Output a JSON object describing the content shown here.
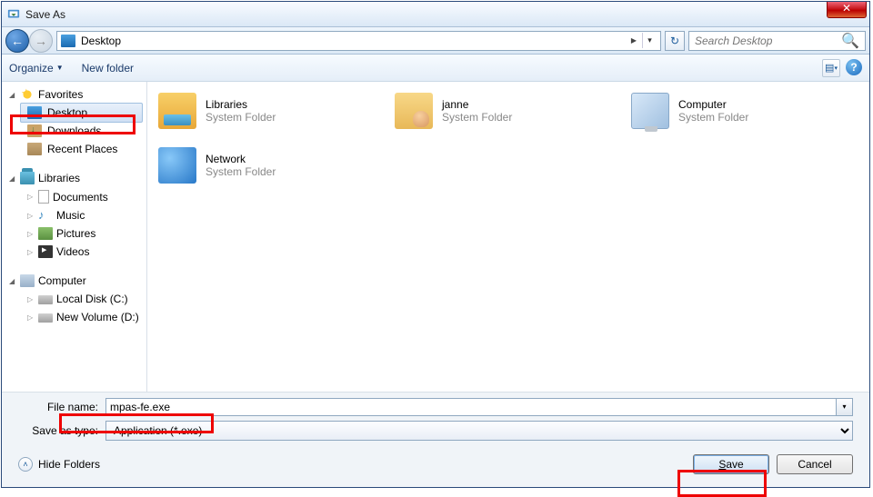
{
  "title": "Save As",
  "addressbar": {
    "location": "Desktop"
  },
  "search": {
    "placeholder": "Search Desktop"
  },
  "toolbar": {
    "organize": "Organize",
    "newfolder": "New folder"
  },
  "nav": {
    "favorites": {
      "label": "Favorites",
      "items": [
        {
          "label": "Desktop"
        },
        {
          "label": "Downloads"
        },
        {
          "label": "Recent Places"
        }
      ]
    },
    "libraries": {
      "label": "Libraries",
      "items": [
        {
          "label": "Documents"
        },
        {
          "label": "Music"
        },
        {
          "label": "Pictures"
        },
        {
          "label": "Videos"
        }
      ]
    },
    "computer": {
      "label": "Computer",
      "items": [
        {
          "label": "Local Disk (C:)"
        },
        {
          "label": "New Volume (D:)"
        }
      ]
    }
  },
  "content": {
    "items": [
      {
        "name": "Libraries",
        "sub": "System Folder"
      },
      {
        "name": "janne",
        "sub": "System Folder"
      },
      {
        "name": "Computer",
        "sub": "System Folder"
      },
      {
        "name": "Network",
        "sub": "System Folder"
      }
    ]
  },
  "filename": {
    "label": "File name:",
    "value": "mpas-fe.exe"
  },
  "savetype": {
    "label": "Save as type:",
    "value": "Application (*.exe)"
  },
  "buttons": {
    "hide": "Hide Folders",
    "save": "Save",
    "cancel": "Cancel"
  }
}
